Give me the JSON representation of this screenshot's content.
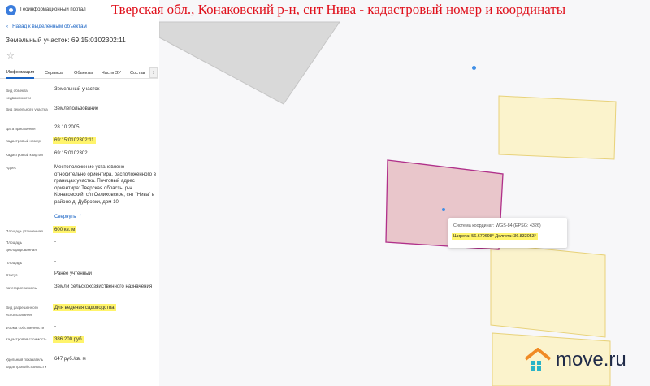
{
  "headline": "Тверская обл., Конаковский р-н, снт Нива - кадастровый номер и координаты",
  "portal": {
    "title": "Геоинформационный портал"
  },
  "panel": {
    "back_label": "Назад к выделенным объектам",
    "title": "Земельный участок: 69:15:0102302:11",
    "tabs": [
      {
        "label": "Информация",
        "active": true
      },
      {
        "label": "Сервисы"
      },
      {
        "label": "Объекты"
      },
      {
        "label": "Части ЗУ"
      },
      {
        "label": "Состав"
      }
    ],
    "fields": [
      {
        "label": "Вид объекта недвижимости",
        "value": "Земельный участок"
      },
      {
        "label": "Вид земельного участка",
        "value": "Землепользование"
      },
      {
        "label": "Дата присвоения",
        "value": "28.10.2005"
      },
      {
        "label": "Кадастровый номер",
        "value": "69:15:0102302:11",
        "highlight": true
      },
      {
        "label": "Кадастровый квартал",
        "value": "69:15:0102302"
      },
      {
        "label": "Адрес",
        "value": "Местоположение установлено относительно ориентира, расположенного в границах участка. Почтовый адрес ориентира: Тверская область, р-н Конаковский, с/п Селиховское, снт \"Нива\" в районе д. Дубровки, дом 10."
      },
      {
        "label": "Площадь уточненная",
        "value": "600 кв. м",
        "highlight": true
      },
      {
        "label": "Площадь декларированная",
        "value": "-"
      },
      {
        "label": "Площадь",
        "value": "-"
      },
      {
        "label": "Статус",
        "value": "Ранее учтенный"
      },
      {
        "label": "Категория земель",
        "value": "Земли сельскохозяйственного назначения"
      },
      {
        "label": "Вид разрешенного использования",
        "value": "Для ведения садоводства",
        "highlight": true
      },
      {
        "label": "Форма собственности",
        "value": "-"
      },
      {
        "label": "Кадастровая стоимость",
        "value": "386 200 руб.",
        "highlight": true
      },
      {
        "label": "Удельный показатель кадастровой стоимости",
        "value": "647 руб./кв. м"
      }
    ],
    "collapse_label": "Свернуть"
  },
  "popup": {
    "coord_system": "Система координат: WGS-84 (EPSG: 4326)",
    "coords": "Широта: 56.670698° Долгота: 36.833053°"
  },
  "colors": {
    "selected_parcel_fill": "#e9c6cb",
    "selected_parcel_stroke": "#b0308a",
    "neighbor_fill": "#fbf3cc",
    "neighbor_stroke": "#e8d27a",
    "highlight": "#fff46b",
    "link": "#1a64c4",
    "headline": "#e0111c"
  },
  "watermark": {
    "text": "move.ru",
    "icon": "house-icon"
  }
}
